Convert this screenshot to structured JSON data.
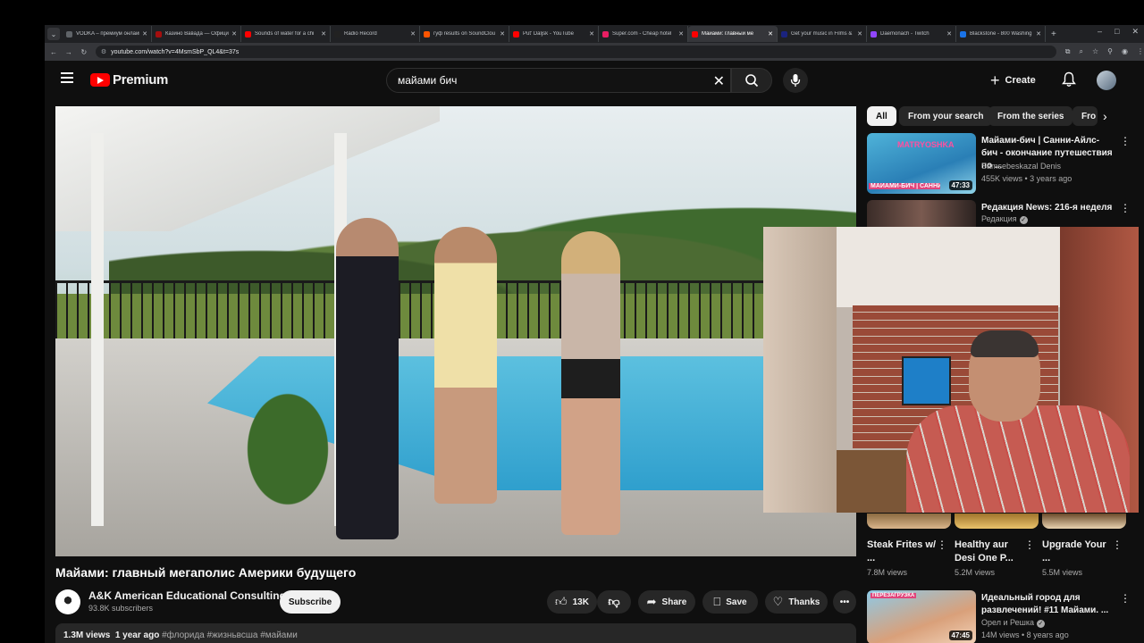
{
  "browser": {
    "tabs": [
      {
        "label": "VODKA – премиум онлайн",
        "color": "#5f6368"
      },
      {
        "label": "Казино Вавада — Офици",
        "color": "#a50e0e"
      },
      {
        "label": "Sounds of water for a chi",
        "color": "#ff0000"
      },
      {
        "label": "Radio Record",
        "color": "#222222"
      },
      {
        "label": "гуф results on SoundClou",
        "color": "#ff5500"
      },
      {
        "label": "Put' Daljsk - YouTube",
        "color": "#ff0000"
      },
      {
        "label": "Super.com - Cheap hotel",
        "color": "#e91e63"
      },
      {
        "label": "Майами: главный ме",
        "color": "#ff0000",
        "active": true
      },
      {
        "label": "Get your music in Films &",
        "color": "#1a237e"
      },
      {
        "label": "Daemonach - Twitch",
        "color": "#9146ff"
      },
      {
        "label": "Blackstone - 800 Washing",
        "color": "#1a73e8"
      }
    ],
    "url": "youtube.com/watch?v=4MsmSbP_QL4&t=37s"
  },
  "header": {
    "logo_text": "Premium",
    "search_value": "майами бич",
    "create_label": "Create"
  },
  "video": {
    "title": "Майами: главный мегаполис Америки будущего",
    "channel": "A&K American Educational Consulting",
    "subscribers": "93.8K subscribers",
    "subscribe_label": "Subscribe",
    "likes": "13K",
    "share_label": "Share",
    "save_label": "Save",
    "thanks_label": "Thanks",
    "views": "1.3M views",
    "age": "1 year ago",
    "hashtags": "#флорида #жизньвсша #майами"
  },
  "chips": [
    "All",
    "From your search",
    "From the series",
    "Fro"
  ],
  "recommendations": [
    {
      "title": "Майами-бич | Санни-Айлс-бич - окончание путешествия по ...",
      "channel": "Samsebeskazal Denis",
      "meta": "455K views • 3 years ago",
      "duration": "47:33",
      "thumb_text": "МАЙАМИ-БИЧ | САННИ-АЙ",
      "thumb_brand": "MATRYOSHKA",
      "thumb_color": "#2a7fb6"
    },
    {
      "title": "Редакция News: 216-я неделя",
      "channel": "Редакция",
      "meta": "",
      "duration": "",
      "thumb_color": "#3a2c28"
    },
    {
      "title": "Идеальный город для развлечений! #11 Майами. ...",
      "channel": "Орел и Решка",
      "meta": "14M views • 8 years ago",
      "duration": "47:45",
      "thumb_text": "ПЕРЕЗАГРУЗКА",
      "thumb_color": "#d9a07a"
    }
  ],
  "shorts": [
    {
      "title": "Steak Frites w/ ...",
      "views": "7.8M views"
    },
    {
      "title": "Healthy aur Desi One P...",
      "views": "5.2M views"
    },
    {
      "title": "Upgrade Your ...",
      "views": "5.5M views"
    }
  ]
}
